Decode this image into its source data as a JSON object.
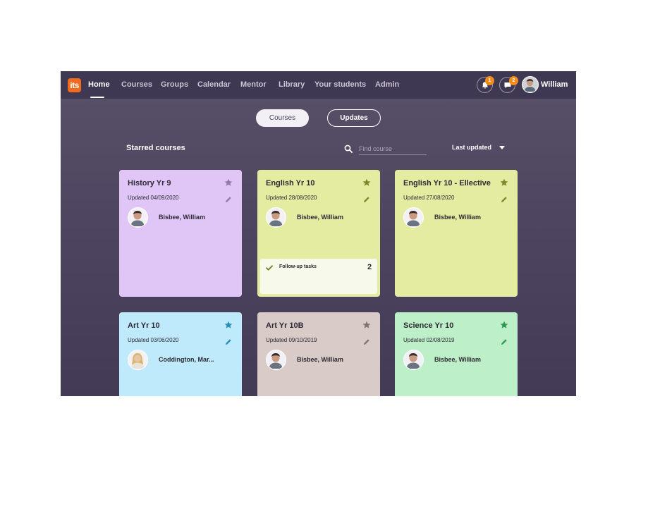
{
  "nav": {
    "logo": "its",
    "items": [
      "Home",
      "Courses",
      "Groups",
      "Calendar",
      "Mentor",
      "Library",
      "Your students",
      "Admin"
    ],
    "active": "Home",
    "notifications_count": "1",
    "messages_count": "2",
    "user_name": "William"
  },
  "toggle": {
    "courses": "Courses",
    "updates": "Updates",
    "selected": "Courses"
  },
  "starred": {
    "title": "Starred courses",
    "search_placeholder": "Find course",
    "sort_value": "Last updated"
  },
  "cards": [
    {
      "title": "History Yr 9",
      "updated": "Updated 04/09/2020",
      "teacher": "Bisbee, William",
      "bg": "#dfc6f7",
      "accent": "#8f7aa8"
    },
    {
      "title": "English Yr 10",
      "updated": "Updated 28/08/2020",
      "teacher": "Bisbee, William",
      "bg": "#e3eca1",
      "accent": "#7e8a2a",
      "task_label": "Follow-up tasks",
      "task_count": "2"
    },
    {
      "title": "English Yr 10 - Ellective",
      "updated": "Updated 27/08/2020",
      "teacher": "Bisbee, William",
      "bg": "#e3eca1",
      "accent": "#7e8a2a"
    },
    {
      "title": "Art Yr 10",
      "updated": "Updated 03/06/2020",
      "teacher": "Coddington, Mar...",
      "bg": "#bfeafc",
      "accent": "#2a8fb8"
    },
    {
      "title": "Art Yr 10B",
      "updated": "Updated 09/10/2019",
      "teacher": "Bisbee, William",
      "bg": "#d9ccc8",
      "accent": "#86736e"
    },
    {
      "title": "Science Yr 10",
      "updated": "Updated 02/08/2019",
      "teacher": "Bisbee, William",
      "bg": "#bdf0c8",
      "accent": "#2f9a4e"
    }
  ]
}
